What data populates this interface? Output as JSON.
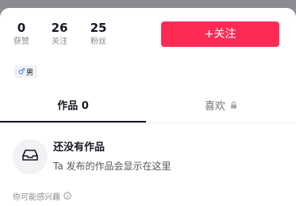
{
  "stats": [
    {
      "value": "0",
      "label": "获赞"
    },
    {
      "value": "26",
      "label": "关注"
    },
    {
      "value": "25",
      "label": "粉丝"
    }
  ],
  "follow_button": "+关注",
  "gender": {
    "icon": "male-icon",
    "symbol": "♂",
    "label": "男"
  },
  "tabs": [
    {
      "label": "作品 0",
      "active": true
    },
    {
      "label": "喜欢",
      "locked": true
    }
  ],
  "empty_state": {
    "icon": "inbox-icon",
    "title": "还没有作品",
    "subtitle": "Ta 发布的作品会显示在这里"
  },
  "suggest": {
    "label": "你可能感兴趣",
    "icon": "info-icon"
  },
  "colors": {
    "accent": "#fe2c55",
    "male": "#2c7df2"
  }
}
